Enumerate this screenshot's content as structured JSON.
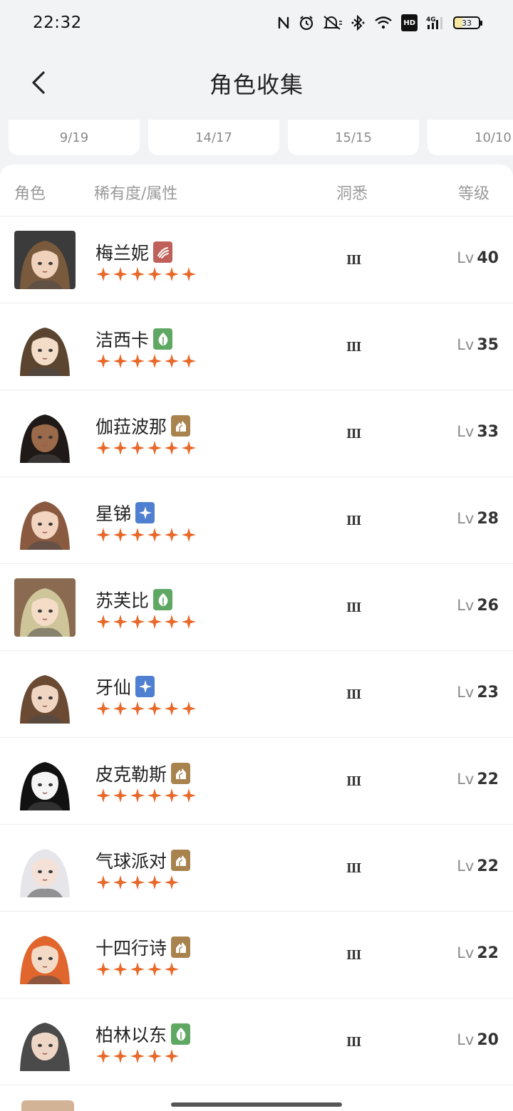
{
  "status_bar": {
    "time": "22:32",
    "battery": "33",
    "network": "4G",
    "hd": "HD",
    "icons": [
      "nfc-icon",
      "alarm-icon",
      "mute-icon",
      "bluetooth-icon",
      "wifi-icon",
      "hd-icon",
      "signal-icon",
      "battery-icon"
    ]
  },
  "header": {
    "title": "角色收集",
    "back_icon": "chevron-left-icon"
  },
  "tabs": [
    {
      "label": "9/19"
    },
    {
      "label": "14/17"
    },
    {
      "label": "15/15"
    },
    {
      "label": "10/10"
    }
  ],
  "columns": {
    "role": "角色",
    "rarity": "稀有度/属性",
    "insight": "洞悉",
    "level": "等级"
  },
  "level_prefix": "Lv",
  "attributes": {
    "beast": {
      "icon": "beast-claw-icon",
      "color": "#c0605a"
    },
    "plant": {
      "icon": "leaf-icon",
      "color": "#5fa863"
    },
    "mineral": {
      "icon": "mineral-icon",
      "color": "#a8834e"
    },
    "star": {
      "icon": "star-sparkle-icon",
      "color": "#4f7fd0"
    }
  },
  "star_color": "#e8692a",
  "characters": [
    {
      "name": "梅兰妮",
      "attribute": "beast",
      "stars": 6,
      "insight": "III",
      "level": "40",
      "avatar_hair": "#7a5a3c",
      "avatar_bg": "#3b3b3b",
      "avatar_skin": "#f0d2bc"
    },
    {
      "name": "洁西卡",
      "attribute": "plant",
      "stars": 6,
      "insight": "III",
      "level": "35",
      "avatar_hair": "#5b4430",
      "avatar_bg": "#ffffff",
      "avatar_skin": "#f3dcc8"
    },
    {
      "name": "伽菈波那",
      "attribute": "mineral",
      "stars": 6,
      "insight": "III",
      "level": "33",
      "avatar_hair": "#1f1a17",
      "avatar_bg": "#ffffff",
      "avatar_skin": "#9a6a4a"
    },
    {
      "name": "星锑",
      "attribute": "star",
      "stars": 6,
      "insight": "III",
      "level": "28",
      "avatar_hair": "#8a5a40",
      "avatar_bg": "#ffffff",
      "avatar_skin": "#f2d4c0"
    },
    {
      "name": "苏芙比",
      "attribute": "plant",
      "stars": 6,
      "insight": "III",
      "level": "26",
      "avatar_hair": "#cfc59a",
      "avatar_bg": "#8a6a50",
      "avatar_skin": "#f4dcc6"
    },
    {
      "name": "牙仙",
      "attribute": "star",
      "stars": 6,
      "insight": "III",
      "level": "23",
      "avatar_hair": "#6b4a33",
      "avatar_bg": "#ffffff",
      "avatar_skin": "#f0d6c2"
    },
    {
      "name": "皮克勒斯",
      "attribute": "mineral",
      "stars": 6,
      "insight": "III",
      "level": "22",
      "avatar_hair": "#111111",
      "avatar_bg": "#ffffff",
      "avatar_skin": "#f5f5f5"
    },
    {
      "name": "气球派对",
      "attribute": "mineral",
      "stars": 5,
      "insight": "III",
      "level": "22",
      "avatar_hair": "#e6e6ea",
      "avatar_bg": "#ffffff",
      "avatar_skin": "#f4e2d8"
    },
    {
      "name": "十四行诗",
      "attribute": "mineral",
      "stars": 5,
      "insight": "III",
      "level": "22",
      "avatar_hair": "#e0662e",
      "avatar_bg": "#ffffff",
      "avatar_skin": "#f3dac6"
    },
    {
      "name": "柏林以东",
      "attribute": "plant",
      "stars": 5,
      "insight": "III",
      "level": "20",
      "avatar_hair": "#4a4a4a",
      "avatar_bg": "#ffffff",
      "avatar_skin": "#eed6c6"
    }
  ]
}
